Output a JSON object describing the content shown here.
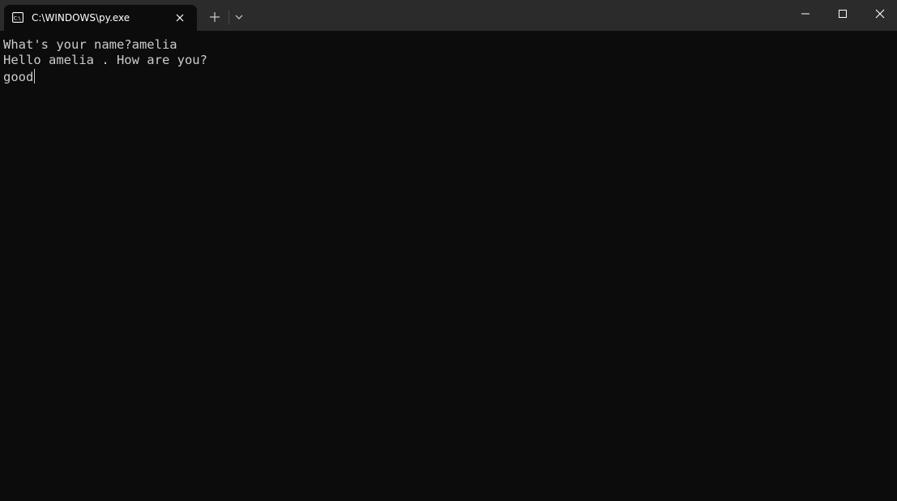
{
  "window": {
    "tab_title": "C:\\WINDOWS\\py.exe"
  },
  "icons": {
    "tab": "console-icon",
    "close_tab": "close-icon",
    "new_tab": "plus-icon",
    "tab_dropdown": "chevron-down-icon",
    "minimize": "minimize-icon",
    "maximize": "maximize-icon",
    "close_window": "close-icon"
  },
  "terminal": {
    "lines": [
      "What's your name?amelia",
      "Hello amelia . How are you?",
      "good"
    ]
  },
  "colors": {
    "titlebar_bg": "#2b2b2b",
    "terminal_bg": "#0c0c0c",
    "terminal_text": "#cccccc"
  }
}
